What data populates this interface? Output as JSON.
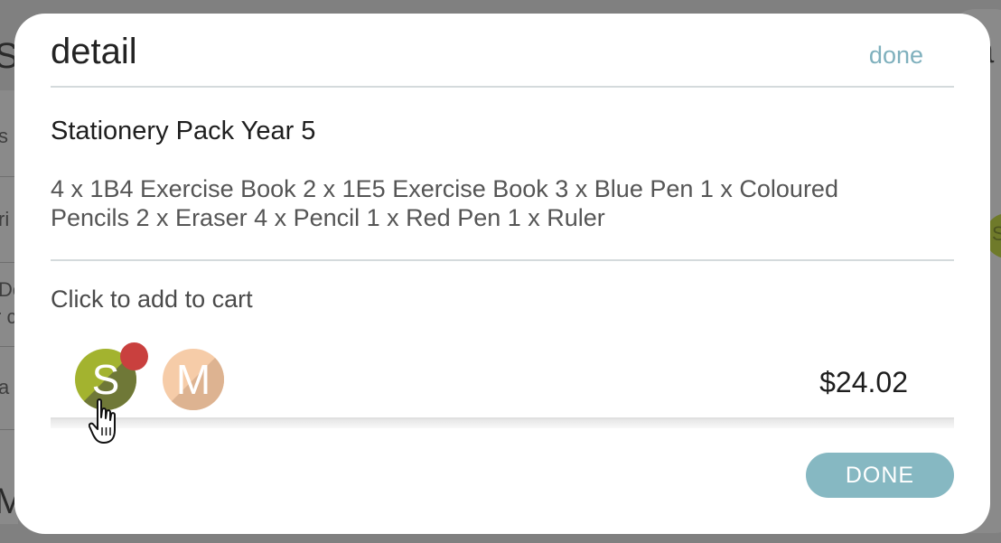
{
  "background": {
    "fragments": [
      "S",
      "s",
      "ri",
      "Dc",
      "r c",
      "a",
      "M",
      "a",
      "S"
    ]
  },
  "modal": {
    "title": "detail",
    "done_link": "done",
    "product": {
      "name": "Stationery Pack Year 5",
      "description": "4 x 1B4 Exercise Book 2 x 1E5 Exercise Book 3 x Blue Pen 1 x Coloured Pencils 2 x Eraser 4 x Pencil 1 x Red Pen 1 x Ruler"
    },
    "cart_hint": "Click to add to cart",
    "avatars": [
      {
        "letter": "S",
        "color": "#a3b32f",
        "has_badge": true
      },
      {
        "letter": "M",
        "color": "#f6cca8",
        "has_badge": false
      }
    ],
    "price": "$24.02",
    "done_button": "DONE"
  },
  "colors": {
    "accent": "#7fb0bd",
    "button": "#86b8c2",
    "badge": "#c9403e"
  },
  "icons": {
    "cursor": "hand-pointer-icon"
  }
}
